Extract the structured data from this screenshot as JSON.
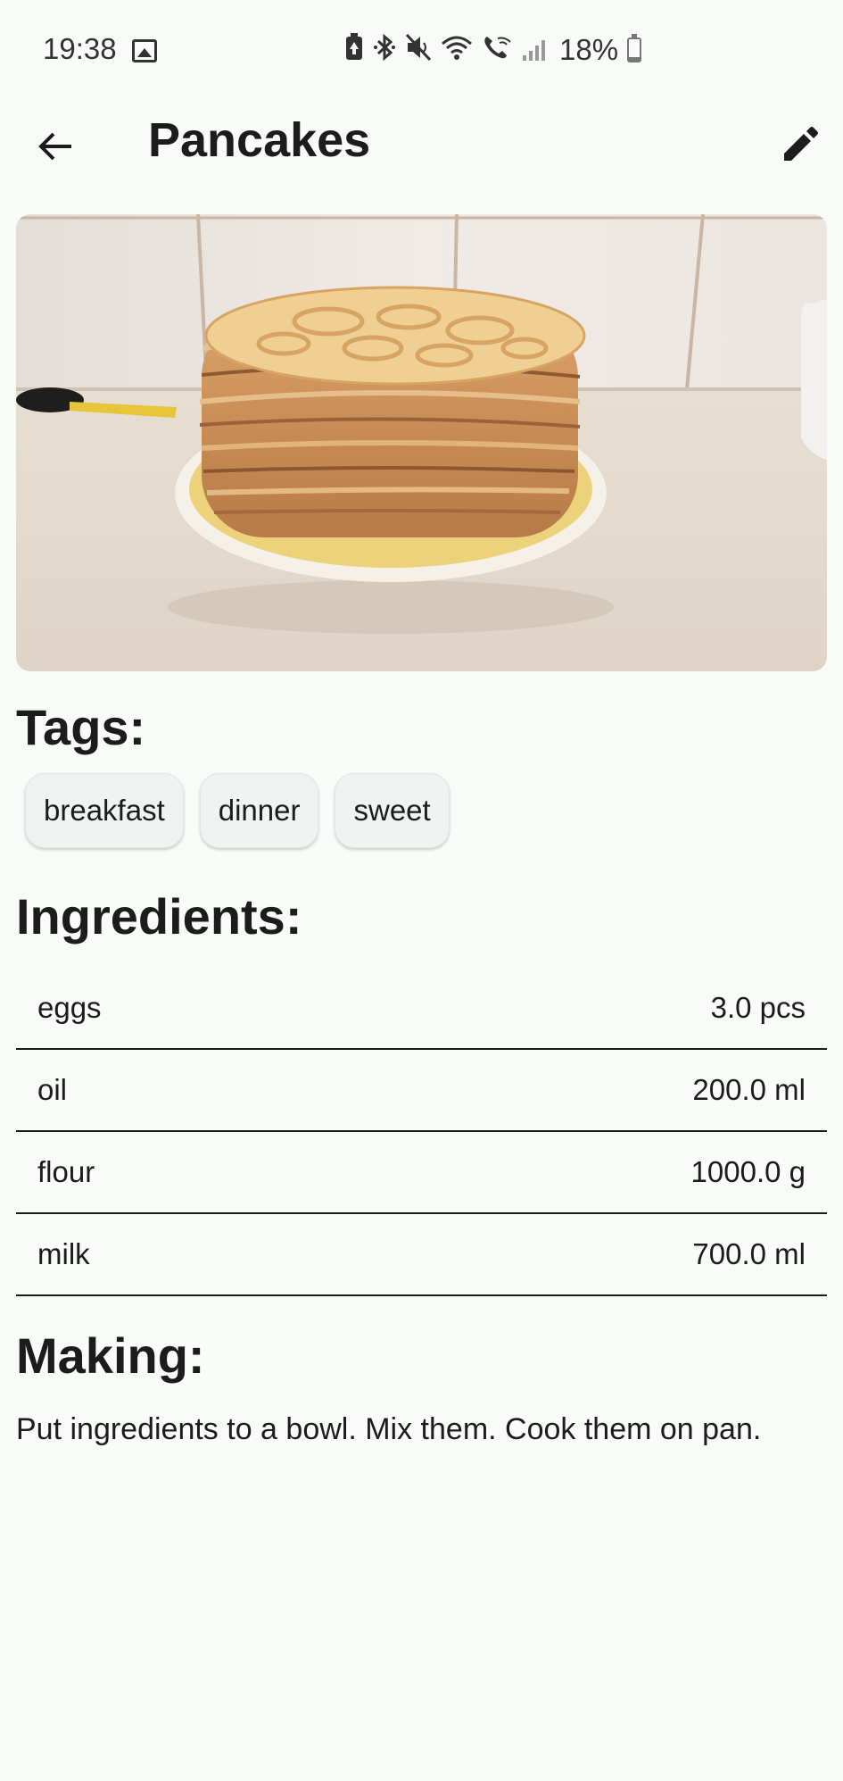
{
  "status_bar": {
    "time": "19:38",
    "battery": "18%",
    "battery_level": 0.18,
    "icons": [
      "gallery-icon",
      "battery-saver-icon",
      "bluetooth-icon",
      "mute-icon",
      "wifi-icon",
      "wifi-calling-icon",
      "signal-icon",
      "battery-icon"
    ]
  },
  "app_bar": {
    "title": "Pancakes",
    "back_icon": "back-arrow-icon",
    "edit_icon": "pencil-icon"
  },
  "hero_image": {
    "subject": "stack of pancakes on a plate"
  },
  "tags": {
    "heading": "Tags:",
    "items": [
      "breakfast",
      "dinner",
      "sweet"
    ]
  },
  "ingredients": {
    "heading": "Ingredients:",
    "items": [
      {
        "name": "eggs",
        "amount": "3.0 pcs"
      },
      {
        "name": "oil",
        "amount": "200.0 ml"
      },
      {
        "name": "flour",
        "amount": "1000.0 g"
      },
      {
        "name": "milk",
        "amount": "700.0 ml"
      }
    ]
  },
  "making": {
    "heading": "Making:",
    "text": "Put ingredients to a bowl. Mix them. Cook them on pan."
  },
  "colors": {
    "background": "#f9fbf9",
    "text": "#1b1c1b",
    "chip": "#eff3f1"
  }
}
